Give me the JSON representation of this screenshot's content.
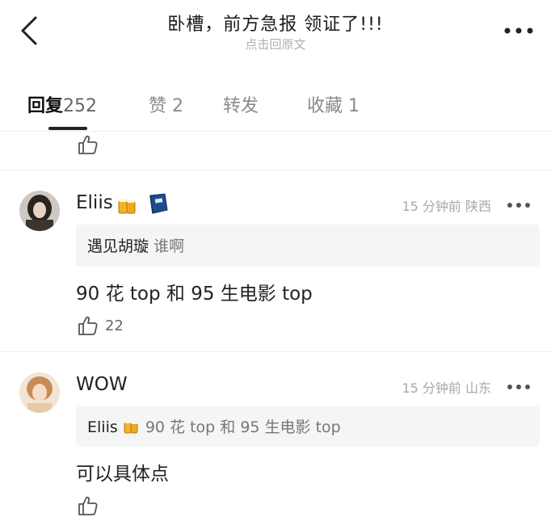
{
  "header": {
    "title": "卧槽，前方急报  领证了!!!",
    "subtitle": "点击回原文"
  },
  "tabs": [
    {
      "label": "回复",
      "count": "252"
    },
    {
      "label": "赞",
      "count": "2"
    },
    {
      "label": "转发",
      "count": ""
    },
    {
      "label": "收藏",
      "count": "1"
    }
  ],
  "comments": [
    {
      "username": "Eliis",
      "meta": "15 分钟前  陕西",
      "quote_user": "遇见胡璇",
      "quote_text": "谁啊",
      "text": "90 花 top 和 95 生电影 top",
      "likes": "22"
    },
    {
      "username": "WOW",
      "meta": "15 分钟前  山东",
      "quote_user": "Eliis",
      "quote_text": "90 花 top 和 95 生电影 top",
      "text": "可以具体点",
      "likes": ""
    }
  ],
  "colors": {
    "background": "#ffffff",
    "text_primary": "#222222",
    "text_secondary": "#a8a8a8",
    "quote_background": "#f5f5f5"
  }
}
